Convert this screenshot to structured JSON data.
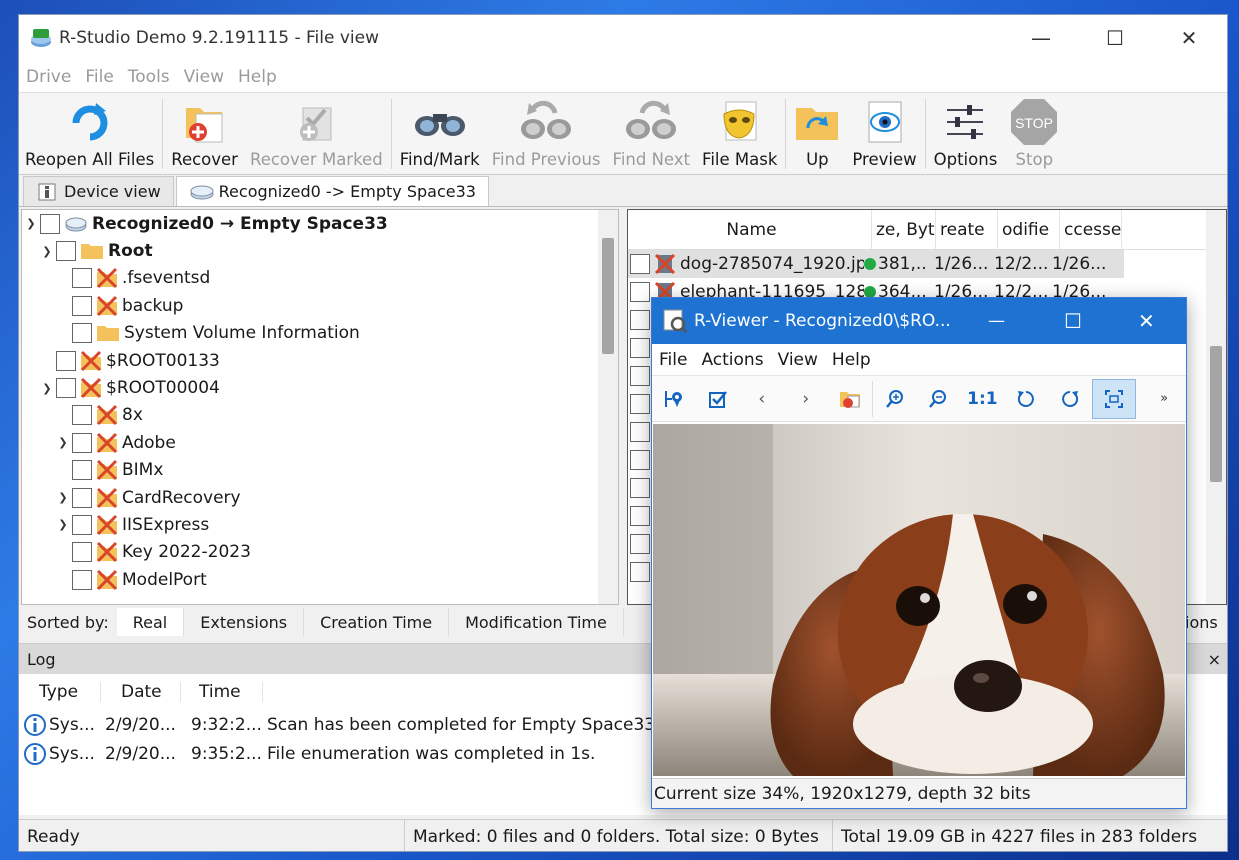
{
  "window": {
    "title": "R-Studio Demo 9.2.191115 - File view"
  },
  "menu": [
    "Drive",
    "File",
    "Tools",
    "View",
    "Help"
  ],
  "toolbar": {
    "reopen": "Reopen All Files",
    "recover": "Recover",
    "recover_marked": "Recover Marked",
    "find_mark": "Find/Mark",
    "find_previous": "Find Previous",
    "find_next": "Find Next",
    "file_mask": "File Mask",
    "up": "Up",
    "preview": "Preview",
    "options": "Options",
    "stop": "Stop",
    "stop_sign": "STOP"
  },
  "tabs": {
    "device": "Device view",
    "recognized": "Recognized0 -> Empty Space33"
  },
  "tree": {
    "root_label": "Recognized0 → Empty Space33",
    "items": [
      "Root",
      ".fseventsd",
      "backup",
      "System Volume Information",
      "$ROOT00133",
      "$ROOT00004",
      "8x",
      "Adobe",
      "BIMx",
      "CardRecovery",
      "IISExpress",
      "Key 2022-2023",
      "ModelPort"
    ]
  },
  "filelist": {
    "headers": [
      "Name",
      "ze, Byt",
      "reate",
      "odifie",
      "ccesse"
    ],
    "rows": [
      {
        "name": "dog-2785074_1920.jp",
        "size": "381,...",
        "created": "1/26...",
        "modified": "12/2...",
        "accessed": "1/26..."
      },
      {
        "name": "elephant-111695_128",
        "size": "364,...",
        "created": "1/26...",
        "modified": "12/2...",
        "accessed": "1/26..."
      }
    ]
  },
  "sortbar": {
    "label": "Sorted by:",
    "tabs": [
      "Real",
      "Extensions",
      "Creation Time",
      "Modification Time"
    ],
    "trailing": "ions"
  },
  "log": {
    "title": "Log",
    "close": "×",
    "headers": [
      "Type",
      "Date",
      "Time"
    ],
    "rows": [
      {
        "type": "Sys...",
        "date": "2/9/20...",
        "time": "9:32:2...",
        "message": "Scan has been completed for Empty Space33"
      },
      {
        "type": "Sys...",
        "date": "2/9/20...",
        "time": "9:35:2...",
        "message": "File enumeration was completed in 1s."
      }
    ]
  },
  "status": {
    "ready": "Ready",
    "marked": "Marked: 0 files and 0 folders. Total size: 0 Bytes",
    "total": "Total 19.09 GB in 4227 files in 283 folders"
  },
  "viewer": {
    "title": "R-Viewer - Recognized0\\$RO...",
    "menu": [
      "File",
      "Actions",
      "View",
      "Help"
    ],
    "one_to_one": "1:1",
    "more": "»",
    "status": "Current size 34%, 1920x1279, depth 32 bits"
  },
  "colors": {
    "accent": "#1e73d2",
    "status_ok": "#22aa44"
  }
}
